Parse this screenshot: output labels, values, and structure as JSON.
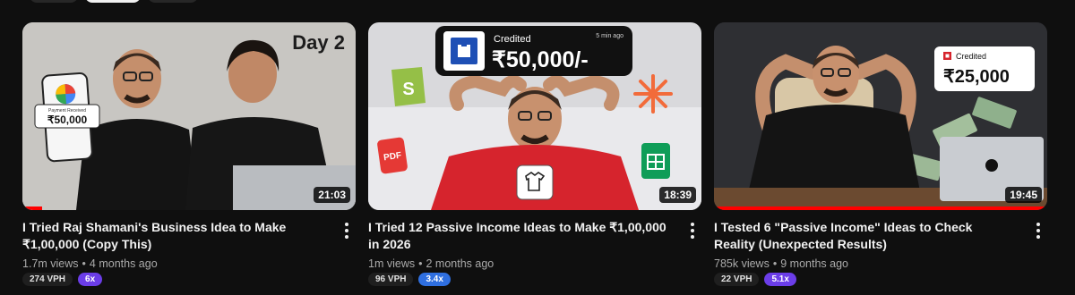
{
  "colors": {
    "background": "#0f0f0f",
    "progress": "#ff0000",
    "multiplier_purple": "#6b3de8",
    "multiplier_blue": "#2f6fe0"
  },
  "icons": {
    "more": "more-vertical-icon"
  },
  "videos": [
    {
      "title": "I Tried Raj Shamani's Business Idea to Make ₹1,00,000 (Copy This)",
      "views": "1.7m views",
      "age": "4 months ago",
      "duration": "21:03",
      "vph": "274 VPH",
      "multiplier": "6x",
      "multiplier_color": "#6b3de8",
      "progress": 0.06,
      "thumb_text": {
        "day": "Day 2",
        "pay_label": "Payment Received",
        "pay_amount": "₹50,000"
      }
    },
    {
      "title": "I Tried 12 Passive Income Ideas to Make ₹1,00,000 in 2026",
      "views": "1m views",
      "age": "2 months ago",
      "duration": "18:39",
      "vph": "96 VPH",
      "multiplier": "3.4x",
      "multiplier_color": "#2f6fe0",
      "progress": 0.0,
      "thumb_text": {
        "credited": "Credited",
        "time": "5 min ago",
        "amount": "₹50,000/-",
        "pdf": "PDF"
      }
    },
    {
      "title": "I Tested 6 \"Passive Income\" Ideas to Check Reality (Unexpected Results)",
      "views": "785k views",
      "age": "9 months ago",
      "duration": "19:45",
      "vph": "22 VPH",
      "multiplier": "5.1x",
      "multiplier_color": "#6b3de8",
      "progress": 1.0,
      "thumb_text": {
        "credited": "Credited",
        "amount": "₹25,000"
      }
    }
  ]
}
